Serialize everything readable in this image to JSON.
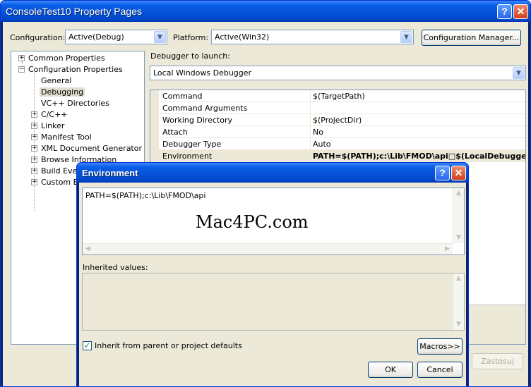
{
  "main_window": {
    "title": "ConsoleTest10 Property Pages",
    "help_glyph": "?",
    "close_glyph": "✕",
    "configuration_label": "Configuration:",
    "configuration_value": "Active(Debug)",
    "platform_label": "Platform:",
    "platform_value": "Active(Win32)",
    "config_manager_label": "Configuration Manager...",
    "debugger_label": "Debugger to launch:",
    "debugger_value": "Local Windows Debugger",
    "apply_label": "Zastosuj"
  },
  "tree": {
    "items": [
      {
        "label": "Common Properties",
        "expander": "+"
      },
      {
        "label": "Configuration Properties",
        "expander": "−"
      },
      {
        "label": "General"
      },
      {
        "label": "Debugging"
      },
      {
        "label": "VC++ Directories"
      },
      {
        "label": "C/C++",
        "expander": "+"
      },
      {
        "label": "Linker",
        "expander": "+"
      },
      {
        "label": "Manifest Tool",
        "expander": "+"
      },
      {
        "label": "XML Document Generator",
        "expander": "+"
      },
      {
        "label": "Browse Information",
        "expander": "+"
      },
      {
        "label": "Build Events",
        "expander": "+"
      },
      {
        "label": "Custom Build Step",
        "expander": "+"
      }
    ]
  },
  "properties": {
    "rows": [
      {
        "name": "Command",
        "value": "$(TargetPath)"
      },
      {
        "name": "Command Arguments",
        "value": ""
      },
      {
        "name": "Working Directory",
        "value": "$(ProjectDir)"
      },
      {
        "name": "Attach",
        "value": "No"
      },
      {
        "name": "Debugger Type",
        "value": "Auto"
      },
      {
        "name": "Environment",
        "value": "PATH=$(PATH);c:\\Lib\\FMOD\\api□$(LocalDebuggerEnvironment)"
      }
    ]
  },
  "env_dialog": {
    "title": "Environment",
    "help_glyph": "?",
    "close_glyph": "✕",
    "value": "PATH=$(PATH);c:\\Lib\\FMOD\\api",
    "watermark": "Mac4PC.com",
    "inherited_label": "Inherited values:",
    "inherit_checkbox_label": "Inherit from parent or project defaults",
    "inherit_checked": true,
    "macros_label": "Macros>>",
    "ok_label": "OK",
    "cancel_label": "Cancel"
  },
  "icons": {
    "dropdown": "chevron-down-icon",
    "scroll_up": "arrow-up-icon",
    "scroll_down": "arrow-down-icon",
    "scroll_left": "arrow-left-icon",
    "scroll_right": "arrow-right-icon",
    "check": "checkmark-icon"
  },
  "colors": {
    "titlebar": "#0453d8",
    "dialog_face": "#ece9d8",
    "border": "#7f9db9",
    "checkmark": "#21a121"
  }
}
